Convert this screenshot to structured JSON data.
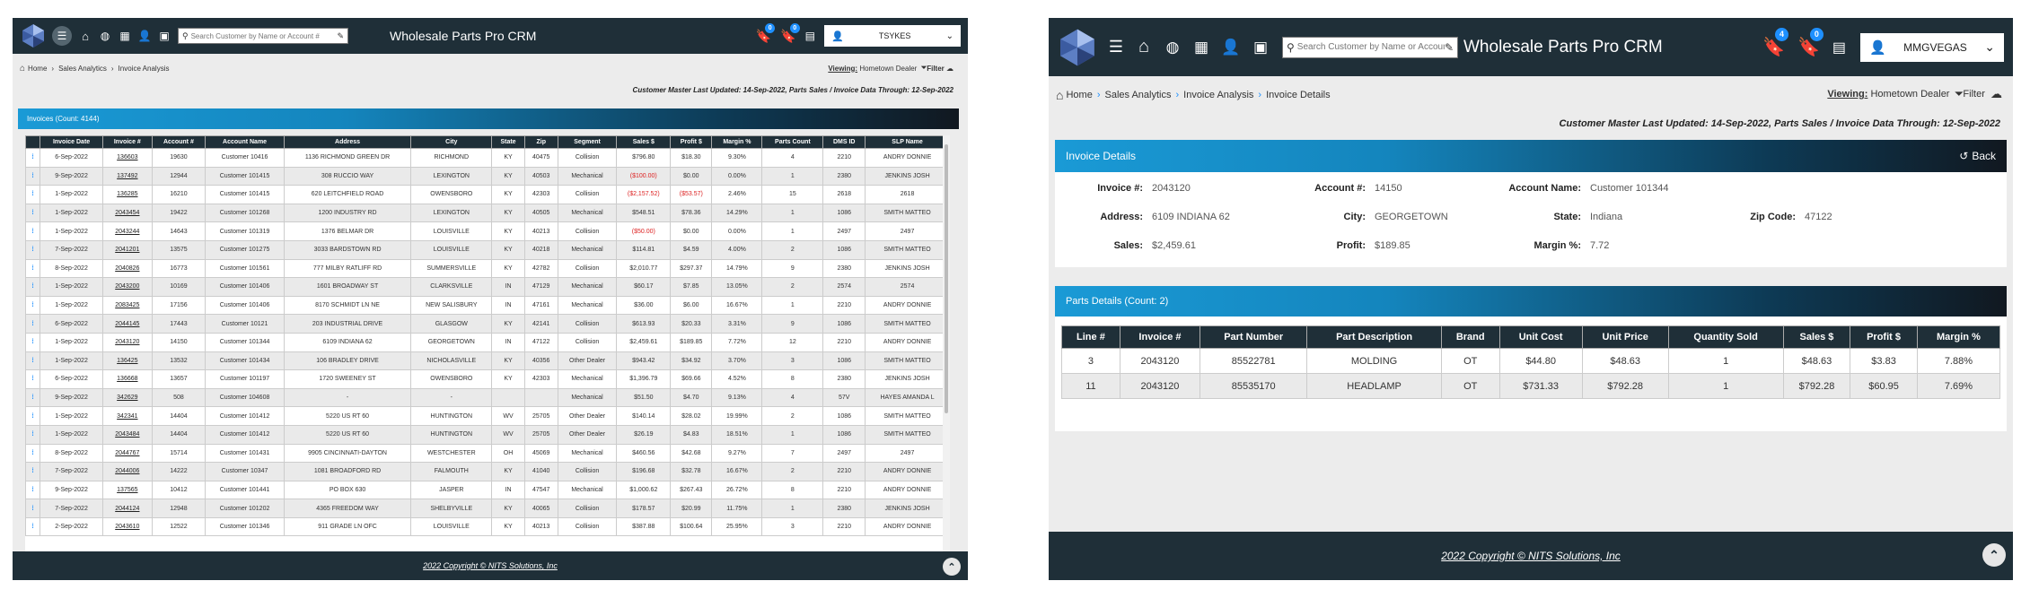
{
  "app": {
    "title": "Wholesale Parts Pro CRM",
    "search_placeholder": "Search Customer by Name or Account #"
  },
  "left": {
    "user": "TSYKES",
    "badges": [
      "0",
      "0"
    ],
    "crumbs": [
      "Home",
      "Sales Analytics",
      "Invoice Analysis"
    ],
    "viewing_label": "Viewing:",
    "viewing_value": "Hometown Dealer",
    "filter_label": "Filter",
    "updated": "Customer Master Last Updated: 14-Sep-2022, Parts Sales / Invoice Data Through: 12-Sep-2022",
    "panel_title": "Invoices (Count: 4144)",
    "columns": [
      "",
      "Invoice Date",
      "Invoice #",
      "Account #",
      "Account Name",
      "Address",
      "City",
      "State",
      "Zip",
      "Segment",
      "Sales $",
      "Profit $",
      "Margin %",
      "Parts Count",
      "DMS ID",
      "SLP Name"
    ],
    "rows": [
      [
        "6-Sep-2022",
        "136603",
        "19630",
        "Customer 10416",
        "1136 RICHMOND GREEN DR",
        "RICHMOND",
        "KY",
        "40475",
        "Collision",
        "$796.80",
        "$18.30",
        "9.30%",
        "4",
        "2210",
        "ANDRY DONNIE"
      ],
      [
        "9-Sep-2022",
        "137492",
        "12944",
        "Customer 101415",
        "308 RUCCIO WAY",
        "LEXINGTON",
        "KY",
        "40503",
        "Mechanical",
        "($100.00)",
        "$0.00",
        "0.00%",
        "1",
        "2380",
        "JENKINS JOSH"
      ],
      [
        "1-Sep-2022",
        "136285",
        "16210",
        "Customer 101415",
        "620 LEITCHFIELD ROAD",
        "OWENSBORO",
        "KY",
        "42303",
        "Collision",
        "($2,157.52)",
        "($53.57)",
        "2.46%",
        "15",
        "2618",
        "2618"
      ],
      [
        "1-Sep-2022",
        "2043454",
        "19422",
        "Customer 101268",
        "1200 INDUSTRY RD",
        "LEXINGTON",
        "KY",
        "40505",
        "Mechanical",
        "$548.51",
        "$78.36",
        "14.29%",
        "1",
        "1086",
        "SMITH MATTEO"
      ],
      [
        "1-Sep-2022",
        "2043244",
        "14643",
        "Customer 101319",
        "1376 BELMAR DR",
        "LOUISVILLE",
        "KY",
        "40213",
        "Collision",
        "($50.00)",
        "$0.00",
        "0.00%",
        "1",
        "2497",
        "2497"
      ],
      [
        "7-Sep-2022",
        "2041201",
        "13575",
        "Customer 101275",
        "3033 BARDSTOWN RD",
        "LOUISVILLE",
        "KY",
        "40218",
        "Mechanical",
        "$114.81",
        "$4.59",
        "4.00%",
        "2",
        "1086",
        "SMITH MATTEO"
      ],
      [
        "8-Sep-2022",
        "2040826",
        "16773",
        "Customer 101561",
        "777 MILBY RATLIFF RD",
        "SUMMERSVILLE",
        "KY",
        "42782",
        "Collision",
        "$2,010.77",
        "$297.37",
        "14.79%",
        "9",
        "2380",
        "JENKINS JOSH"
      ],
      [
        "1-Sep-2022",
        "2043200",
        "10169",
        "Customer 101406",
        "1601 BROADWAY ST",
        "CLARKSVILLE",
        "IN",
        "47129",
        "Mechanical",
        "$60.17",
        "$7.85",
        "13.05%",
        "2",
        "2574",
        "2574"
      ],
      [
        "1-Sep-2022",
        "2083425",
        "17156",
        "Customer 101406",
        "8170 SCHMIDT LN NE",
        "NEW SALISBURY",
        "IN",
        "47161",
        "Mechanical",
        "$36.00",
        "$6.00",
        "16.67%",
        "1",
        "2210",
        "ANDRY DONNIE"
      ],
      [
        "6-Sep-2022",
        "2044145",
        "17443",
        "Customer 10121",
        "203 INDUSTRIAL DRIVE",
        "GLASGOW",
        "KY",
        "42141",
        "Collision",
        "$613.93",
        "$20.33",
        "3.31%",
        "9",
        "1086",
        "SMITH MATTEO"
      ],
      [
        "1-Sep-2022",
        "2043120",
        "14150",
        "Customer 101344",
        "6109 INDIANA 62",
        "GEORGETOWN",
        "IN",
        "47122",
        "Collision",
        "$2,459.61",
        "$189.85",
        "7.72%",
        "12",
        "2210",
        "ANDRY DONNIE"
      ],
      [
        "1-Sep-2022",
        "136425",
        "13532",
        "Customer 101434",
        "106 BRADLEY DRIVE",
        "NICHOLASVILLE",
        "KY",
        "40356",
        "Other Dealer",
        "$943.42",
        "$34.92",
        "3.70%",
        "3",
        "1086",
        "SMITH MATTEO"
      ],
      [
        "6-Sep-2022",
        "136668",
        "13657",
        "Customer 101197",
        "1720 SWEENEY ST",
        "OWENSBORO",
        "KY",
        "42303",
        "Mechanical",
        "$1,396.79",
        "$69.66",
        "4.52%",
        "8",
        "2380",
        "JENKINS JOSH"
      ],
      [
        "9-Sep-2022",
        "342629",
        "508",
        "Customer 104608",
        "-",
        "-",
        "",
        "",
        "Mechanical",
        "$51.50",
        "$4.70",
        "9.13%",
        "4",
        "57V",
        "HAYES AMANDA L"
      ],
      [
        "1-Sep-2022",
        "342341",
        "14404",
        "Customer 101412",
        "5220 US RT 60",
        "HUNTINGTON",
        "WV",
        "25705",
        "Other Dealer",
        "$140.14",
        "$28.02",
        "19.99%",
        "2",
        "1086",
        "SMITH MATTEO"
      ],
      [
        "1-Sep-2022",
        "2043484",
        "14404",
        "Customer 101412",
        "5220 US RT 60",
        "HUNTINGTON",
        "WV",
        "25705",
        "Other Dealer",
        "$26.19",
        "$4.83",
        "18.51%",
        "1",
        "1086",
        "SMITH MATTEO"
      ],
      [
        "8-Sep-2022",
        "2044767",
        "15714",
        "Customer 101431",
        "9905 CINCINNATI-DAYTON",
        "WESTCHESTER",
        "OH",
        "45069",
        "Mechanical",
        "$460.56",
        "$42.68",
        "9.27%",
        "7",
        "2497",
        "2497"
      ],
      [
        "7-Sep-2022",
        "2044006",
        "14222",
        "Customer 10347",
        "1081 BROADFORD RD",
        "FALMOUTH",
        "KY",
        "41040",
        "Collision",
        "$196.68",
        "$32.78",
        "16.67%",
        "2",
        "2210",
        "ANDRY DONNIE"
      ],
      [
        "9-Sep-2022",
        "137565",
        "10412",
        "Customer 101441",
        "PO BOX 630",
        "JASPER",
        "IN",
        "47547",
        "Mechanical",
        "$1,000.62",
        "$267.43",
        "26.72%",
        "8",
        "2210",
        "ANDRY DONNIE"
      ],
      [
        "7-Sep-2022",
        "2044124",
        "12948",
        "Customer 101202",
        "4365 FREEDOM WAY",
        "SHELBYVILLE",
        "KY",
        "40065",
        "Collision",
        "$178.57",
        "$20.99",
        "11.75%",
        "1",
        "2380",
        "JENKINS JOSH"
      ],
      [
        "2-Sep-2022",
        "2043610",
        "12522",
        "Customer 101346",
        "911 GRADE LN OFC",
        "LOUISVILLE",
        "KY",
        "40213",
        "Collision",
        "$387.88",
        "$100.64",
        "25.95%",
        "3",
        "2210",
        "ANDRY DONNIE"
      ]
    ],
    "copyright": "2022 Copyright © NITS Solutions, Inc"
  },
  "right": {
    "user": "MMGVEGAS",
    "badges": [
      "4",
      "0"
    ],
    "crumbs": [
      "Home",
      "Sales Analytics",
      "Invoice Analysis",
      "Invoice Details"
    ],
    "viewing_label": "Viewing:",
    "viewing_value": "Hometown Dealer",
    "filter_label": "Filter",
    "updated": "Customer Master Last Updated: 14-Sep-2022, Parts Sales / Invoice Data Through: 12-Sep-2022",
    "details_title": "Invoice Details",
    "back_label": "Back",
    "details": {
      "invoice_label": "Invoice #:",
      "invoice": "2043120",
      "account_label": "Account #:",
      "account": "14150",
      "account_name_label": "Account Name:",
      "account_name": "Customer 101344",
      "address_label": "Address:",
      "address": "6109 INDIANA 62",
      "city_label": "City:",
      "city": "GEORGETOWN",
      "state_label": "State:",
      "state": "Indiana",
      "zip_label": "Zip Code:",
      "zip": "47122",
      "sales_label": "Sales:",
      "sales": "$2,459.61",
      "profit_label": "Profit:",
      "profit": "$189.85",
      "margin_label": "Margin %:",
      "margin": "7.72"
    },
    "parts_title": "Parts Details (Count: 2)",
    "parts_columns": [
      "Line #",
      "Invoice #",
      "Part Number",
      "Part Description",
      "Brand",
      "Unit Cost",
      "Unit Price",
      "Quantity Sold",
      "Sales $",
      "Profit $",
      "Margin %"
    ],
    "parts_rows": [
      [
        "3",
        "2043120",
        "85522781",
        "MOLDING",
        "OT",
        "$44.80",
        "$48.63",
        "1",
        "$48.63",
        "$3.83",
        "7.88%"
      ],
      [
        "11",
        "2043120",
        "85535170",
        "HEADLAMP",
        "OT",
        "$731.33",
        "$792.28",
        "1",
        "$792.28",
        "$60.95",
        "7.69%"
      ]
    ],
    "copyright": "2022 Copyright © NITS Solutions, Inc"
  }
}
